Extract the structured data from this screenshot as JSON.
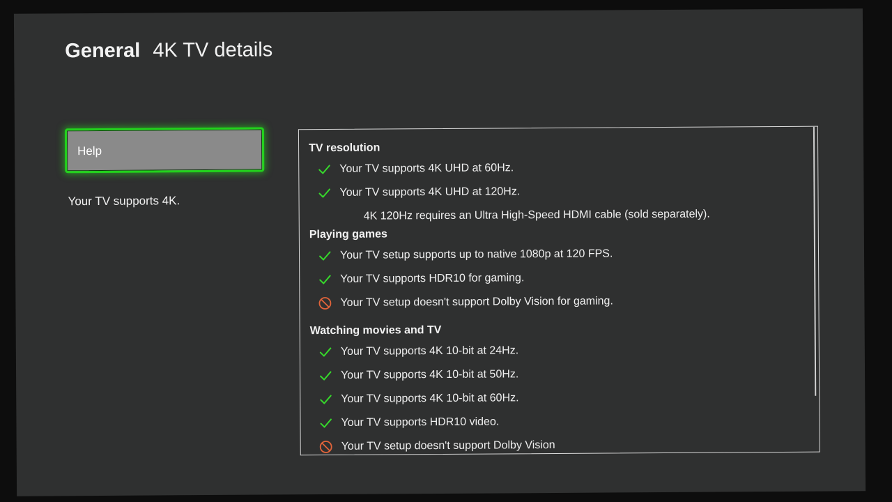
{
  "header": {
    "section": "General",
    "page_title": "4K TV details"
  },
  "sidebar": {
    "help_label": "Help",
    "summary": "Your TV supports 4K."
  },
  "colors": {
    "accent_green": "#22d21c",
    "check_green": "#36d92b",
    "blocked_orange": "#e2643a"
  },
  "details": {
    "tv_resolution": {
      "heading": "TV resolution",
      "items": [
        {
          "icon": "check-icon",
          "text": "Your TV supports 4K UHD at 60Hz."
        },
        {
          "icon": "check-icon",
          "text": "Your TV supports 4K UHD at 120Hz."
        }
      ],
      "note": "4K 120Hz requires an Ultra High-Speed HDMI cable (sold separately)."
    },
    "playing_games": {
      "heading": "Playing games",
      "items": [
        {
          "icon": "check-icon",
          "text": "Your TV setup supports up to native 1080p at 120 FPS."
        },
        {
          "icon": "check-icon",
          "text": "Your TV supports HDR10 for gaming."
        },
        {
          "icon": "blocked-icon",
          "text": "Your TV setup doesn't support Dolby Vision for gaming."
        }
      ]
    },
    "watching_movies": {
      "heading": "Watching movies and TV",
      "items": [
        {
          "icon": "check-icon",
          "text": "Your TV supports 4K 10-bit at 24Hz."
        },
        {
          "icon": "check-icon",
          "text": "Your TV supports 4K 10-bit at 50Hz."
        },
        {
          "icon": "check-icon",
          "text": "Your TV supports 4K 10-bit at 60Hz."
        },
        {
          "icon": "check-icon",
          "text": "Your TV supports HDR10 video."
        },
        {
          "icon": "blocked-icon",
          "text": "Your TV setup doesn't support Dolby Vision"
        }
      ]
    }
  }
}
